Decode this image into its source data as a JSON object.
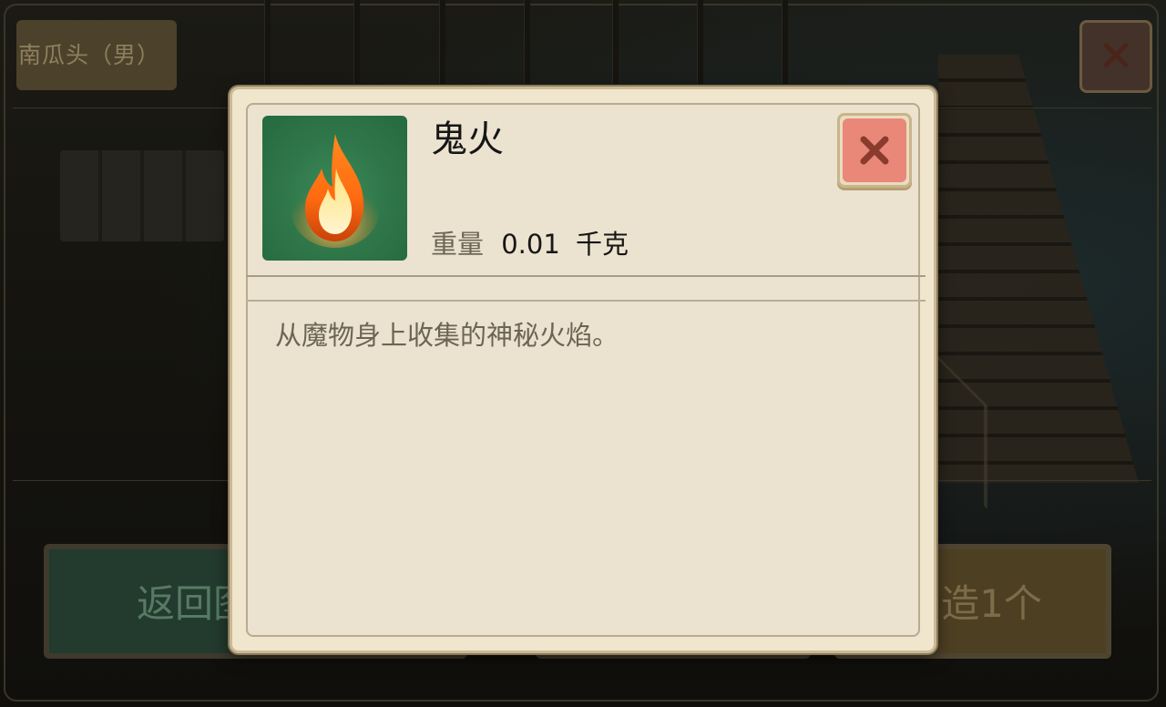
{
  "background": {
    "top_tag": "南瓜头（男）",
    "back_button_label": "返回图",
    "craft_button_label": "造1个"
  },
  "dialog": {
    "item_name": "鬼火",
    "weight_label": "重量",
    "weight_value": "0.01",
    "weight_unit": "千克",
    "description": "从魔物身上收集的神秘火焰。",
    "icon": "fire-icon",
    "close_icon": "close-icon"
  },
  "colors": {
    "dialog_bg": "#efe6cd",
    "icon_bg": "#2e7548",
    "close_btn": "#e98778",
    "close_x": "#8a3b2e"
  }
}
